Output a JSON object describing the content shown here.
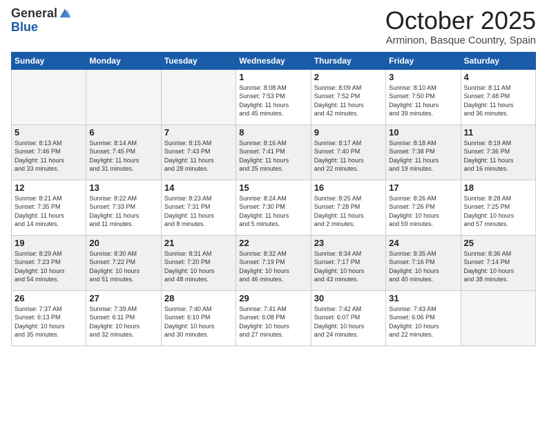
{
  "header": {
    "logo_general": "General",
    "logo_blue": "Blue",
    "month_title": "October 2025",
    "subtitle": "Arminon, Basque Country, Spain"
  },
  "weekdays": [
    "Sunday",
    "Monday",
    "Tuesday",
    "Wednesday",
    "Thursday",
    "Friday",
    "Saturday"
  ],
  "weeks": [
    [
      {
        "day": "",
        "info": ""
      },
      {
        "day": "",
        "info": ""
      },
      {
        "day": "",
        "info": ""
      },
      {
        "day": "1",
        "info": "Sunrise: 8:08 AM\nSunset: 7:53 PM\nDaylight: 11 hours\nand 45 minutes."
      },
      {
        "day": "2",
        "info": "Sunrise: 8:09 AM\nSunset: 7:52 PM\nDaylight: 11 hours\nand 42 minutes."
      },
      {
        "day": "3",
        "info": "Sunrise: 8:10 AM\nSunset: 7:50 PM\nDaylight: 11 hours\nand 39 minutes."
      },
      {
        "day": "4",
        "info": "Sunrise: 8:11 AM\nSunset: 7:48 PM\nDaylight: 11 hours\nand 36 minutes."
      }
    ],
    [
      {
        "day": "5",
        "info": "Sunrise: 8:13 AM\nSunset: 7:46 PM\nDaylight: 11 hours\nand 33 minutes."
      },
      {
        "day": "6",
        "info": "Sunrise: 8:14 AM\nSunset: 7:45 PM\nDaylight: 11 hours\nand 31 minutes."
      },
      {
        "day": "7",
        "info": "Sunrise: 8:15 AM\nSunset: 7:43 PM\nDaylight: 11 hours\nand 28 minutes."
      },
      {
        "day": "8",
        "info": "Sunrise: 8:16 AM\nSunset: 7:41 PM\nDaylight: 11 hours\nand 25 minutes."
      },
      {
        "day": "9",
        "info": "Sunrise: 8:17 AM\nSunset: 7:40 PM\nDaylight: 11 hours\nand 22 minutes."
      },
      {
        "day": "10",
        "info": "Sunrise: 8:18 AM\nSunset: 7:38 PM\nDaylight: 11 hours\nand 19 minutes."
      },
      {
        "day": "11",
        "info": "Sunrise: 8:19 AM\nSunset: 7:36 PM\nDaylight: 11 hours\nand 16 minutes."
      }
    ],
    [
      {
        "day": "12",
        "info": "Sunrise: 8:21 AM\nSunset: 7:35 PM\nDaylight: 11 hours\nand 14 minutes."
      },
      {
        "day": "13",
        "info": "Sunrise: 8:22 AM\nSunset: 7:33 PM\nDaylight: 11 hours\nand 11 minutes."
      },
      {
        "day": "14",
        "info": "Sunrise: 8:23 AM\nSunset: 7:31 PM\nDaylight: 11 hours\nand 8 minutes."
      },
      {
        "day": "15",
        "info": "Sunrise: 8:24 AM\nSunset: 7:30 PM\nDaylight: 11 hours\nand 5 minutes."
      },
      {
        "day": "16",
        "info": "Sunrise: 8:25 AM\nSunset: 7:28 PM\nDaylight: 11 hours\nand 2 minutes."
      },
      {
        "day": "17",
        "info": "Sunrise: 8:26 AM\nSunset: 7:26 PM\nDaylight: 10 hours\nand 59 minutes."
      },
      {
        "day": "18",
        "info": "Sunrise: 8:28 AM\nSunset: 7:25 PM\nDaylight: 10 hours\nand 57 minutes."
      }
    ],
    [
      {
        "day": "19",
        "info": "Sunrise: 8:29 AM\nSunset: 7:23 PM\nDaylight: 10 hours\nand 54 minutes."
      },
      {
        "day": "20",
        "info": "Sunrise: 8:30 AM\nSunset: 7:22 PM\nDaylight: 10 hours\nand 51 minutes."
      },
      {
        "day": "21",
        "info": "Sunrise: 8:31 AM\nSunset: 7:20 PM\nDaylight: 10 hours\nand 48 minutes."
      },
      {
        "day": "22",
        "info": "Sunrise: 8:32 AM\nSunset: 7:19 PM\nDaylight: 10 hours\nand 46 minutes."
      },
      {
        "day": "23",
        "info": "Sunrise: 8:34 AM\nSunset: 7:17 PM\nDaylight: 10 hours\nand 43 minutes."
      },
      {
        "day": "24",
        "info": "Sunrise: 8:35 AM\nSunset: 7:16 PM\nDaylight: 10 hours\nand 40 minutes."
      },
      {
        "day": "25",
        "info": "Sunrise: 8:36 AM\nSunset: 7:14 PM\nDaylight: 10 hours\nand 38 minutes."
      }
    ],
    [
      {
        "day": "26",
        "info": "Sunrise: 7:37 AM\nSunset: 6:13 PM\nDaylight: 10 hours\nand 35 minutes."
      },
      {
        "day": "27",
        "info": "Sunrise: 7:39 AM\nSunset: 6:11 PM\nDaylight: 10 hours\nand 32 minutes."
      },
      {
        "day": "28",
        "info": "Sunrise: 7:40 AM\nSunset: 6:10 PM\nDaylight: 10 hours\nand 30 minutes."
      },
      {
        "day": "29",
        "info": "Sunrise: 7:41 AM\nSunset: 6:08 PM\nDaylight: 10 hours\nand 27 minutes."
      },
      {
        "day": "30",
        "info": "Sunrise: 7:42 AM\nSunset: 6:07 PM\nDaylight: 10 hours\nand 24 minutes."
      },
      {
        "day": "31",
        "info": "Sunrise: 7:43 AM\nSunset: 6:06 PM\nDaylight: 10 hours\nand 22 minutes."
      },
      {
        "day": "",
        "info": ""
      }
    ]
  ]
}
